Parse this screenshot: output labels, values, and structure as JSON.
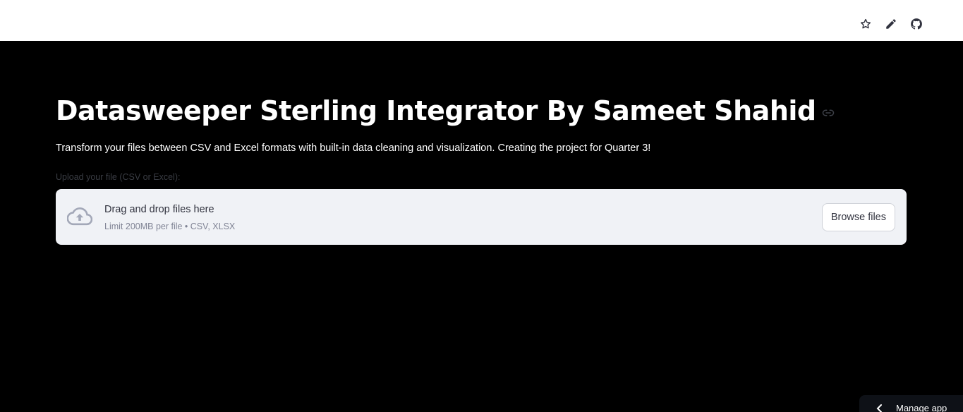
{
  "topbar": {
    "icons": [
      "star-icon",
      "edit-icon",
      "github-icon"
    ]
  },
  "main": {
    "title": "Datasweeper Sterling Integrator By Sameet Shahid",
    "subtitle": "Transform your files between CSV and Excel formats with built-in data cleaning and visualization. Creating the project for Quarter 3!",
    "uploader": {
      "label": "Upload your file (CSV or Excel):",
      "drop_text": "Drag and drop files here",
      "limit_text": "Limit 200MB per file • CSV, XLSX",
      "browse_label": "Browse files"
    }
  },
  "footer": {
    "manage_label": "Manage app"
  },
  "colors": {
    "background": "#000000",
    "topbar": "#ffffff",
    "dropzone": "#f0f2f6",
    "text_dark": "#31333f",
    "text_muted": "#808495"
  }
}
